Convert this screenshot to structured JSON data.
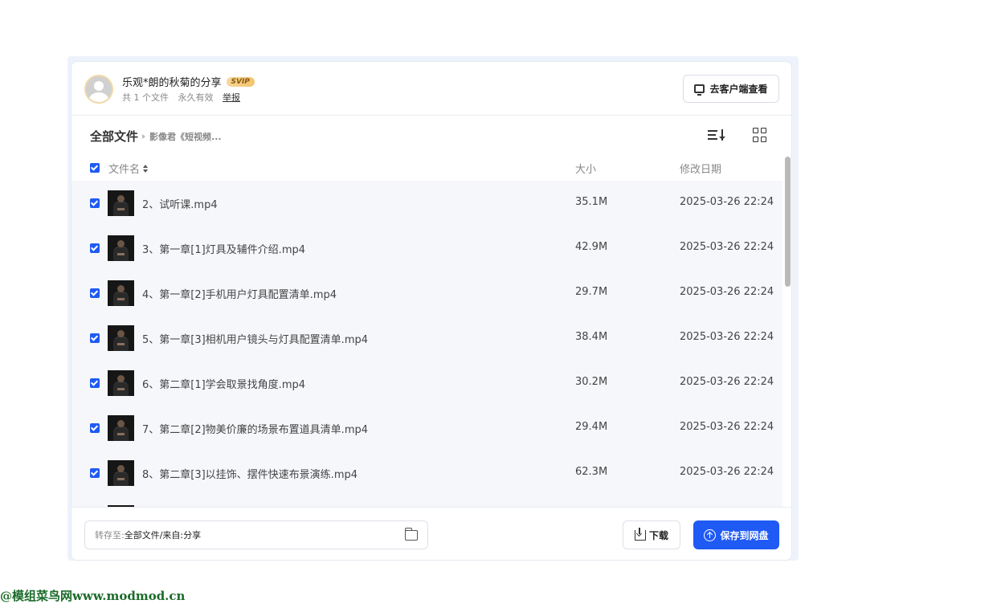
{
  "header": {
    "sharer_title": "乐观*朗的秋菊的分享",
    "badge": "SVIP",
    "file_count": "共 1 个文件",
    "validity": "永久有效",
    "report": "举报",
    "client_button": "去客户端查看"
  },
  "breadcrumb": {
    "root": "全部文件",
    "current": "影像君《短视频..."
  },
  "icons": {
    "sort": "sort-list-icon",
    "grid": "grid-view-icon",
    "folder": "folder-icon",
    "download": "download-icon",
    "save": "cloud-upload-icon"
  },
  "columns": {
    "name": "文件名",
    "size": "大小",
    "date": "修改日期"
  },
  "files": [
    {
      "name": "2、试听课.mp4",
      "size": "35.1M",
      "date": "2025-03-26 22:24"
    },
    {
      "name": "3、第一章[1]灯具及辅件介绍.mp4",
      "size": "42.9M",
      "date": "2025-03-26 22:24"
    },
    {
      "name": "4、第一章[2]手机用户灯具配置清单.mp4",
      "size": "29.7M",
      "date": "2025-03-26 22:24"
    },
    {
      "name": "5、第一章[3]相机用户镜头与灯具配置清单.mp4",
      "size": "38.4M",
      "date": "2025-03-26 22:24"
    },
    {
      "name": "6、第二章[1]学会取景找角度.mp4",
      "size": "30.2M",
      "date": "2025-03-26 22:24"
    },
    {
      "name": "7、第二章[2]物美价廉的场景布置道具清单.mp4",
      "size": "29.4M",
      "date": "2025-03-26 22:24"
    },
    {
      "name": "8、第二章[3]以挂饰、摆件快速布景演练.mp4",
      "size": "62.3M",
      "date": "2025-03-26 22:24"
    }
  ],
  "footer": {
    "save_to_label": "转存至:",
    "save_to_value": "全部文件/来自:分享",
    "download_button": "下载",
    "save_button": "保存到网盘"
  },
  "watermark": "@模组菜鸟网www.modmod.cn",
  "colors": {
    "accent": "#1f5af5",
    "row_bg": "#f6f7fb",
    "badge_gold": "#f2c46c"
  }
}
